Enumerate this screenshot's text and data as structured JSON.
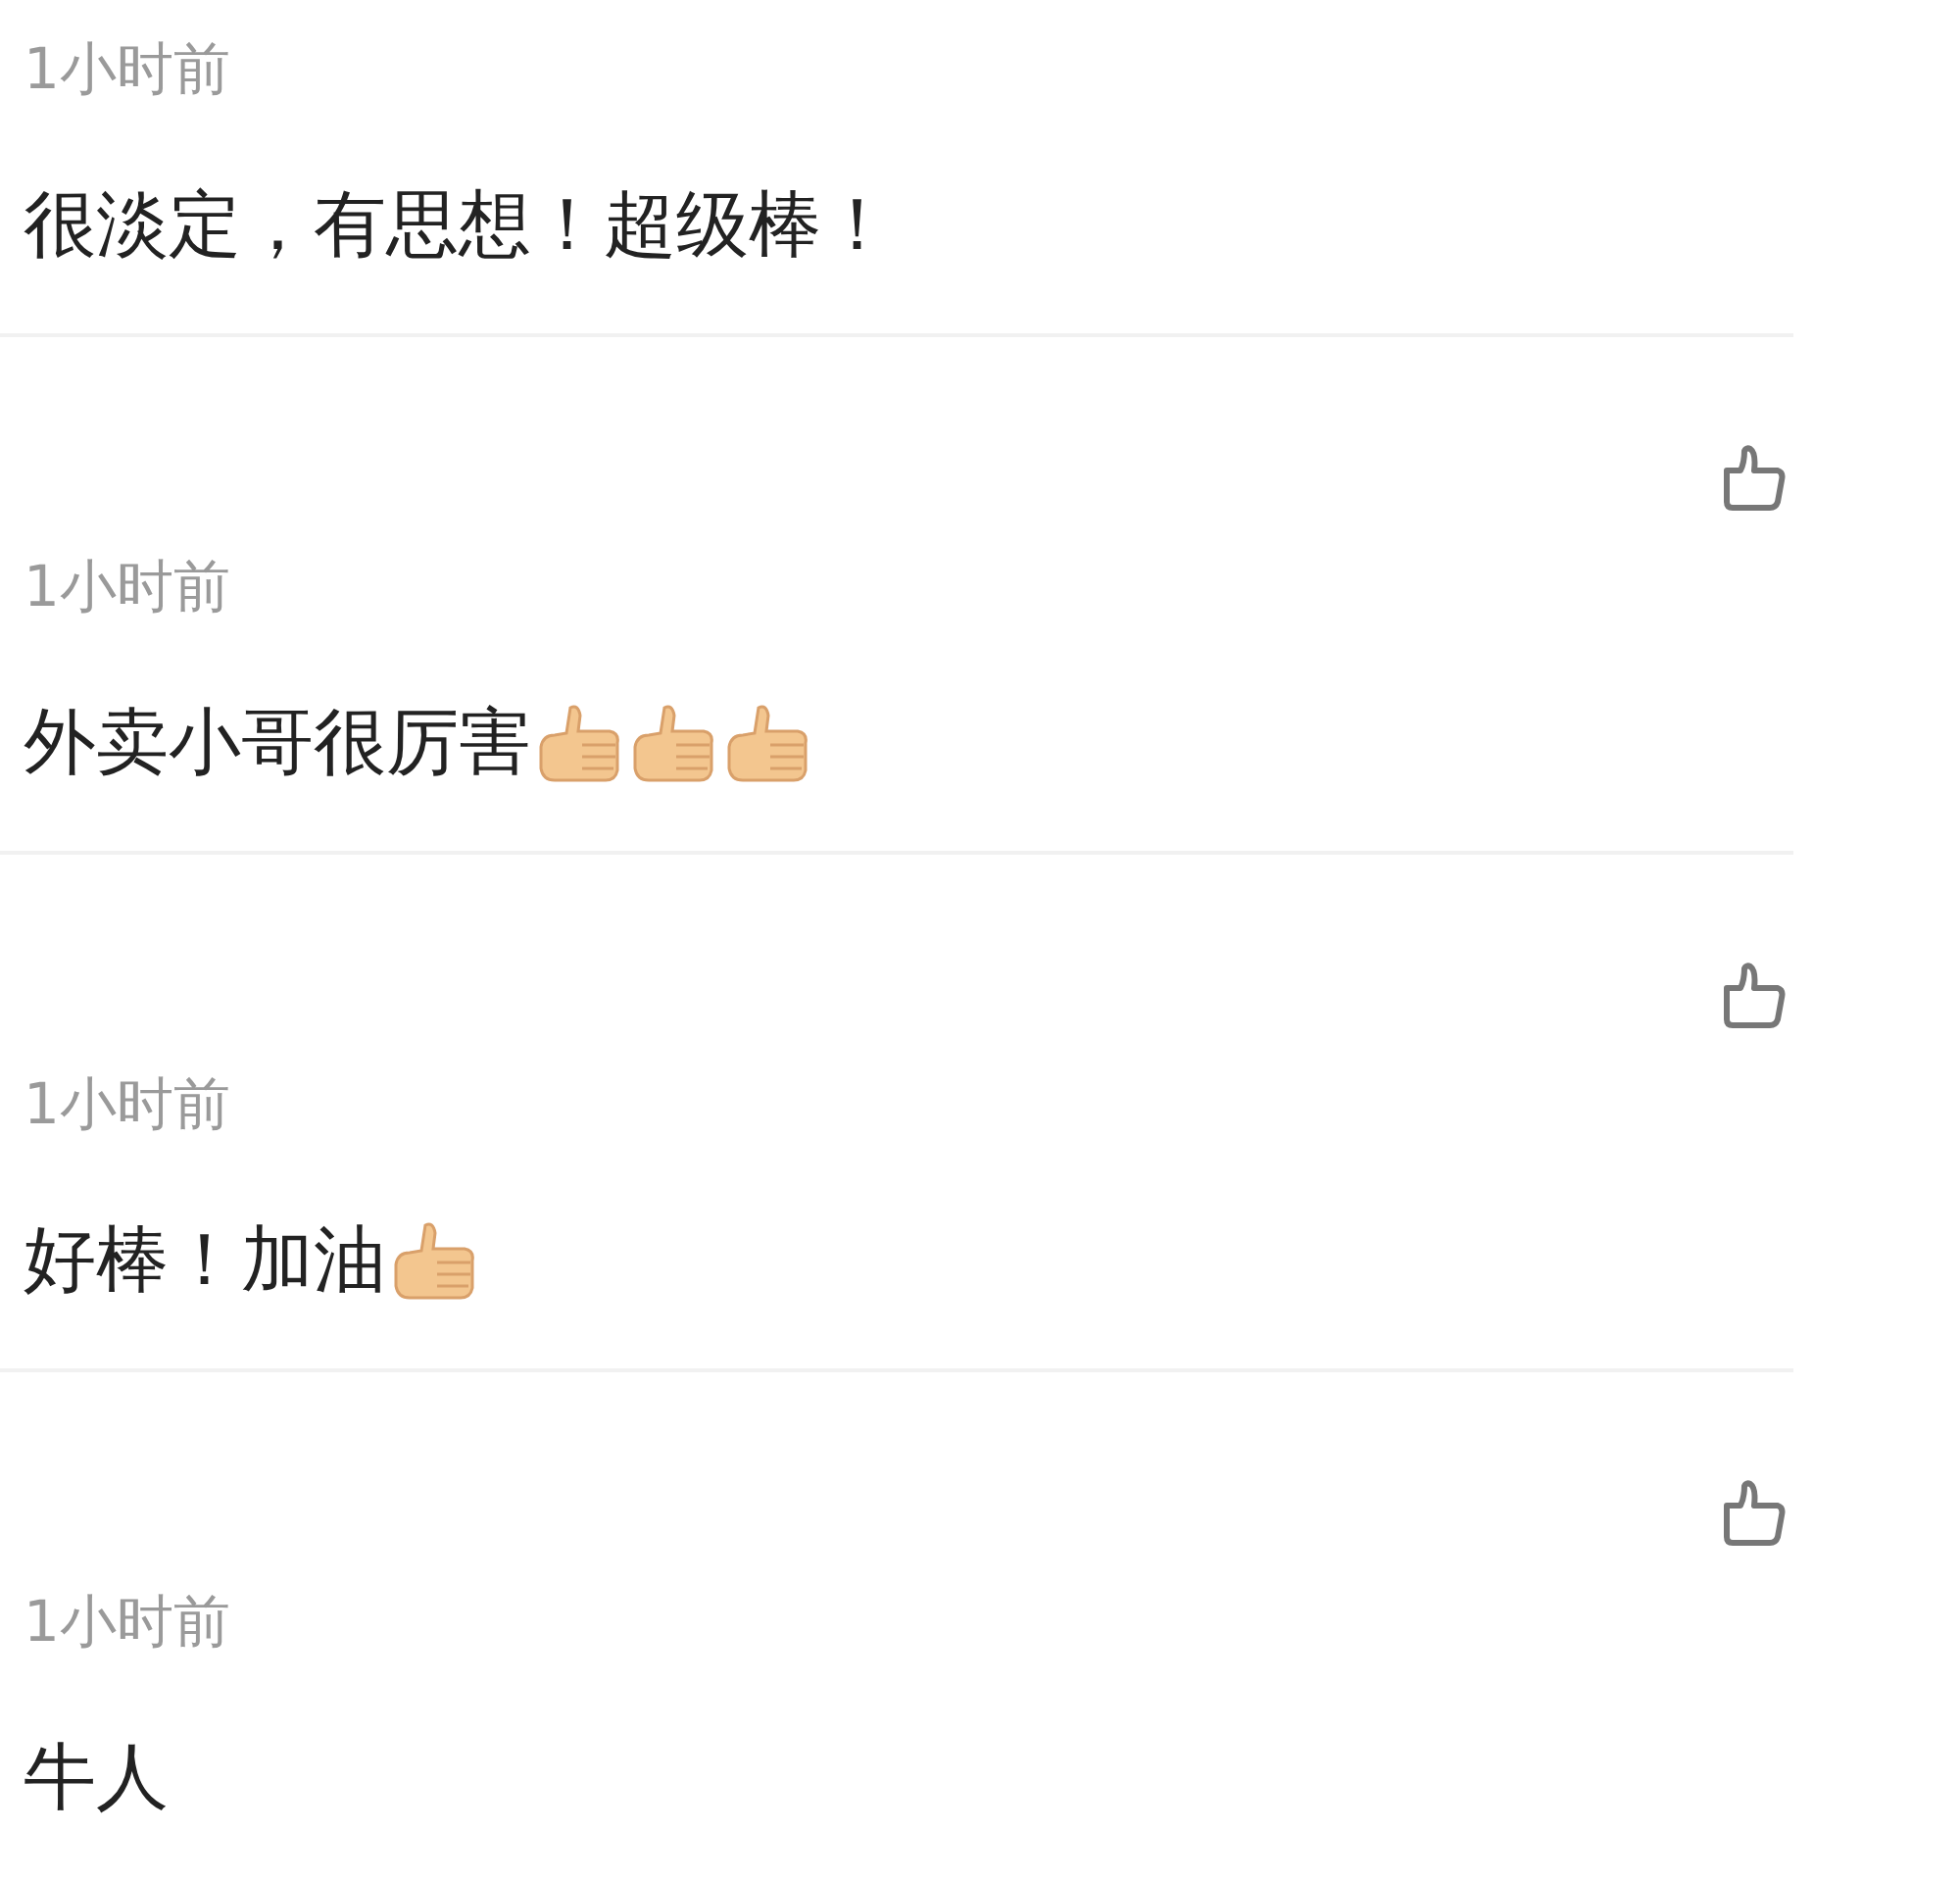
{
  "comments": [
    {
      "like_button": false,
      "time": "1小时前",
      "text": "很淡定，有思想！超级棒！"
    },
    {
      "like_button": true,
      "time": "1小时前",
      "text": "外卖小哥很厉害",
      "emojis": [
        {
          "kind": "thumbs_up"
        },
        {
          "kind": "thumbs_up"
        },
        {
          "kind": "thumbs_up"
        }
      ]
    },
    {
      "like_button": true,
      "time": "1小时前",
      "text": "好棒！加油",
      "emojis": [
        {
          "kind": "thumbs_up"
        }
      ]
    },
    {
      "like_button": true,
      "time": "1小时前",
      "text": "牛人"
    }
  ]
}
